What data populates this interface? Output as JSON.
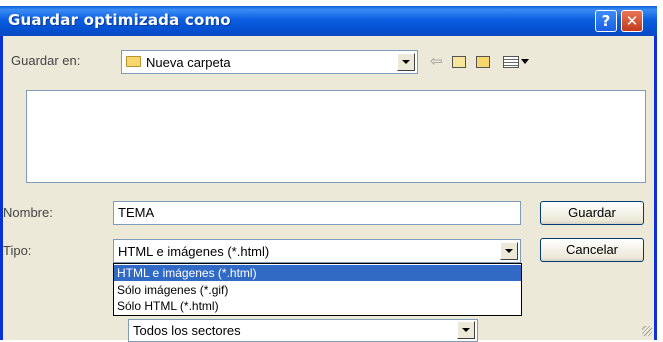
{
  "window": {
    "title": "Guardar optimizada como",
    "help_glyph": "?",
    "close_glyph": "✕"
  },
  "save_in": {
    "label": "Guardar en:",
    "value": "Nueva carpeta",
    "toolbar_icons": [
      "back-icon",
      "up-folder-icon",
      "new-folder-icon",
      "view-menu-icon"
    ]
  },
  "file_name": {
    "label": "Nombre:",
    "value": "TEMA"
  },
  "file_type": {
    "label": "Tipo:",
    "value": "HTML e imágenes (*.html)",
    "options": [
      "HTML e imágenes (*.html)",
      "Sólo imágenes (*.gif)",
      "Sólo HTML (*.html)"
    ],
    "selected_index": 0
  },
  "sectors": {
    "value": "Todos los sectores"
  },
  "buttons": {
    "save": "Guardar",
    "cancel": "Cancelar"
  },
  "colors": {
    "titlebar": "#0a5fd8",
    "selection": "#316ac5",
    "dialog_bg": "#ece9d8"
  }
}
